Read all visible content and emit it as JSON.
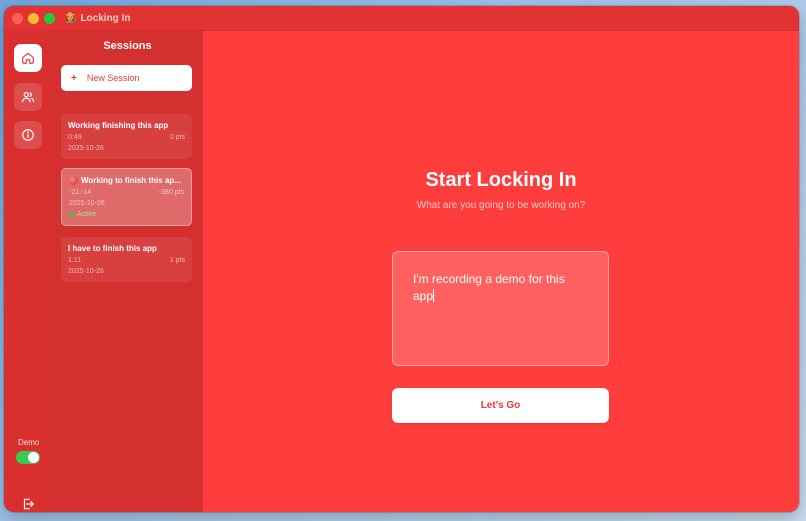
{
  "window": {
    "title": "Locking In",
    "title_icon": "👩‍🌾"
  },
  "sidebar": {
    "nav": [
      {
        "name": "home",
        "icon": "home-icon"
      },
      {
        "name": "users",
        "icon": "users-icon"
      },
      {
        "name": "info",
        "icon": "info-icon"
      }
    ],
    "demo_label": "Demo",
    "demo_toggle_on": true
  },
  "sessions": {
    "title": "Sessions",
    "new_label": "New Session",
    "items": [
      {
        "title": "Working finishing this app",
        "duration": "0:49",
        "points": "0 pts",
        "date": "2025-10-26"
      },
      {
        "title": "Working to finish this ap...",
        "duration": "-21:-14",
        "points": "-380 pts",
        "date": "2025-10-26",
        "status": "Active"
      },
      {
        "title": "I have to finish this app",
        "duration": "1:11",
        "points": "1 pts",
        "date": "2025-10-26"
      }
    ]
  },
  "main": {
    "headline": "Start Locking In",
    "subline": "What are you going to be working on?",
    "input_value": "I'm recording a demo for this app",
    "button_label": "Let's Go"
  },
  "colors": {
    "accent": "#ff3d3d",
    "sidebar": "#d53030",
    "active_green": "#3ac84e"
  }
}
